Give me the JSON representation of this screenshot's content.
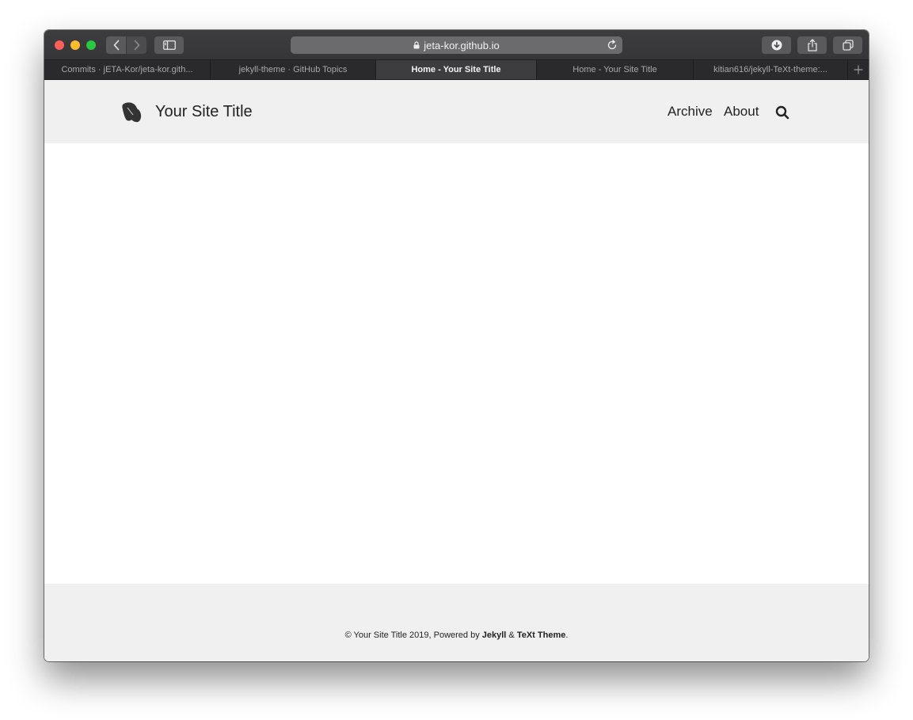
{
  "browser": {
    "address": "jeta-kor.github.io",
    "tabs": [
      {
        "label": "Commits · jETA-Kor/jeta-kor.gith...",
        "active": false
      },
      {
        "label": "jekyll-theme · GitHub Topics",
        "active": false
      },
      {
        "label": "Home - Your Site Title",
        "active": true
      },
      {
        "label": "Home - Your Site Title",
        "active": false
      },
      {
        "label": "kitian616/jekyll-TeXt-theme:...",
        "active": false
      }
    ],
    "colors": {
      "close": "#fe5f57",
      "minimize": "#febc2e",
      "zoom": "#28c840"
    }
  },
  "site": {
    "title": "Your Site Title",
    "nav": {
      "archive": "Archive",
      "about": "About"
    },
    "logo_icon": "ginkgo-leaf-icon",
    "search_icon": "search-icon"
  },
  "footer": {
    "prefix": "© Your Site Title 2019, Powered by ",
    "jekyll": "Jekyll",
    "amp": " & ",
    "theme": "TeXt Theme",
    "suffix": "."
  }
}
